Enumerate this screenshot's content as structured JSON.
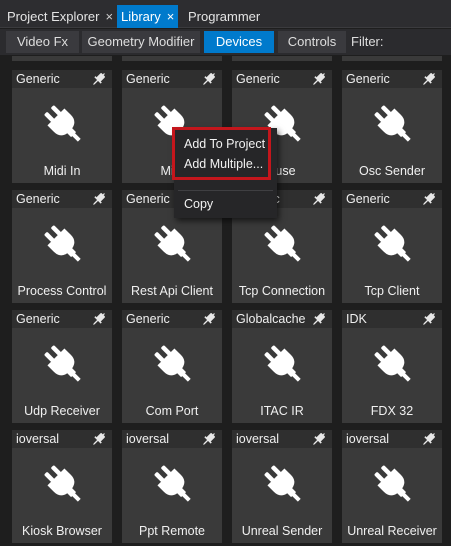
{
  "tabs": [
    {
      "label": "Project Explorer",
      "close": "×"
    },
    {
      "label": "Library",
      "close": "×"
    },
    {
      "label": "Programmer",
      "close": ""
    }
  ],
  "subtabs": [
    "Video Fx",
    "Geometry Modifier",
    "Devices",
    "Controls"
  ],
  "filter_label": "Filter:",
  "icons": {
    "pin": "pin-icon",
    "plug": "plug-icon"
  },
  "colors": {
    "accent": "#007acc",
    "card": "#3a3a3a",
    "highlight": "#c4161c"
  },
  "cards": [
    {
      "vendor": "Generic",
      "name": "Midi In"
    },
    {
      "vendor": "Generic",
      "name": "Midi"
    },
    {
      "vendor": "Generic",
      "name": "ouse"
    },
    {
      "vendor": "Generic",
      "name": "Osc Sender"
    },
    {
      "vendor": "Generic",
      "name": "Process Control"
    },
    {
      "vendor": "Generic",
      "name": "Rest Api Client"
    },
    {
      "vendor": "Generic",
      "name": "Tcp Connection"
    },
    {
      "vendor": "Generic",
      "name": "Tcp Client"
    },
    {
      "vendor": "Generic",
      "name": "Udp Receiver"
    },
    {
      "vendor": "Generic",
      "name": "Com Port"
    },
    {
      "vendor": "Globalcache",
      "name": "ITAC IR"
    },
    {
      "vendor": "IDK",
      "name": "FDX 32"
    },
    {
      "vendor": "ioversal",
      "name": "Kiosk Browser"
    },
    {
      "vendor": "ioversal",
      "name": "Ppt Remote"
    },
    {
      "vendor": "ioversal",
      "name": "Unreal Sender"
    },
    {
      "vendor": "ioversal",
      "name": "Unreal Receiver"
    }
  ],
  "context_menu": {
    "items": [
      "Add To Project",
      "Add Multiple...",
      "Copy"
    ]
  }
}
